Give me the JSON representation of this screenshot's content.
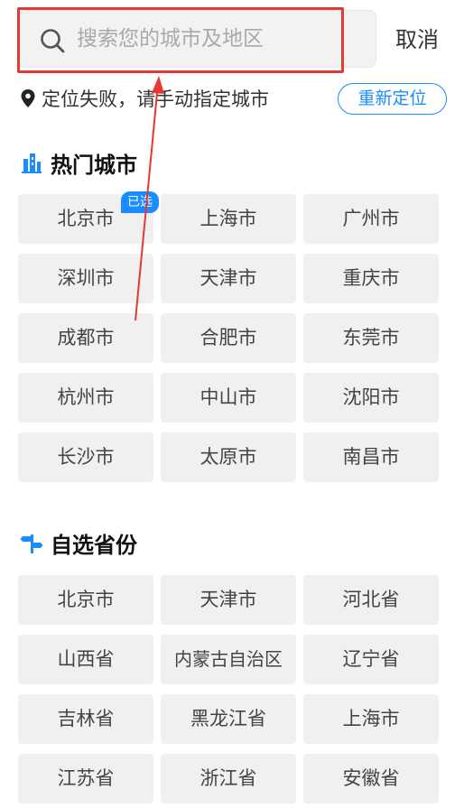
{
  "search": {
    "placeholder": "搜索您的城市及地区"
  },
  "cancel_label": "取消",
  "location": {
    "status": "定位失败，请手动指定城市",
    "relocate_label": "重新定位"
  },
  "hot_cities": {
    "title": "热门城市",
    "selected_badge": "已选",
    "items": [
      "北京市",
      "上海市",
      "广州市",
      "深圳市",
      "天津市",
      "重庆市",
      "成都市",
      "合肥市",
      "东莞市",
      "杭州市",
      "中山市",
      "沈阳市",
      "长沙市",
      "太原市",
      "南昌市"
    ]
  },
  "provinces": {
    "title": "自选省份",
    "items": [
      "北京市",
      "天津市",
      "河北省",
      "山西省",
      "内蒙古自治区",
      "辽宁省",
      "吉林省",
      "黑龙江省",
      "上海市",
      "江苏省",
      "浙江省",
      "安徽省"
    ]
  },
  "colors": {
    "accent": "#1a8cff",
    "annotation": "#e53935",
    "cell_bg": "#f0f0f0"
  }
}
